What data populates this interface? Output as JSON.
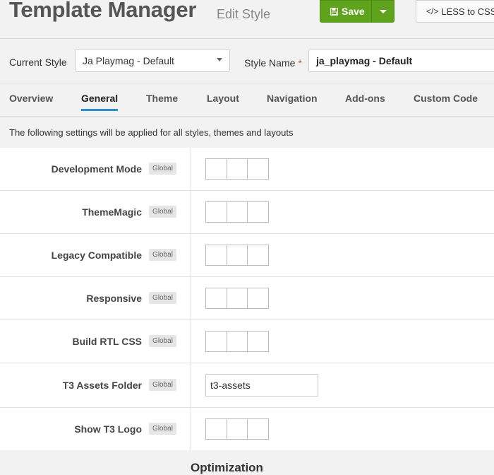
{
  "header": {
    "title": "Template Manager",
    "subtitle": "Edit Style",
    "save_label": "Save",
    "less_label": "LESS to CSS"
  },
  "style_row": {
    "current_style_label": "Current Style",
    "current_style_value": "Ja Playmag - Default",
    "style_name_label": "Style Name",
    "required_mark": "*",
    "style_name_value": "ja_playmag - Default"
  },
  "tabs": [
    {
      "label": "Overview",
      "active": false
    },
    {
      "label": "General",
      "active": true
    },
    {
      "label": "Theme",
      "active": false
    },
    {
      "label": "Layout",
      "active": false
    },
    {
      "label": "Navigation",
      "active": false
    },
    {
      "label": "Add-ons",
      "active": false
    },
    {
      "label": "Custom Code",
      "active": false
    }
  ],
  "intro": "The following settings will be applied for all styles, themes and layouts",
  "badge_label": "Global",
  "settings": [
    {
      "label": "Development Mode",
      "control": "toggle"
    },
    {
      "label": "ThemeMagic",
      "control": "toggle"
    },
    {
      "label": "Legacy Compatible",
      "control": "toggle"
    },
    {
      "label": "Responsive",
      "control": "toggle"
    },
    {
      "label": "Build RTL CSS",
      "control": "toggle"
    },
    {
      "label": "T3 Assets Folder",
      "control": "text",
      "value": "t3-assets"
    },
    {
      "label": "Show T3 Logo",
      "control": "toggle"
    }
  ],
  "section_title": "Optimization",
  "colors": {
    "save_green": "#5fa31c",
    "tab_active_underline": "#2b8fcf",
    "required_red": "#d9534f"
  },
  "icons": {
    "save": "floppy-icon",
    "less": "code-icon",
    "dropdown": "chevron-down-icon"
  }
}
